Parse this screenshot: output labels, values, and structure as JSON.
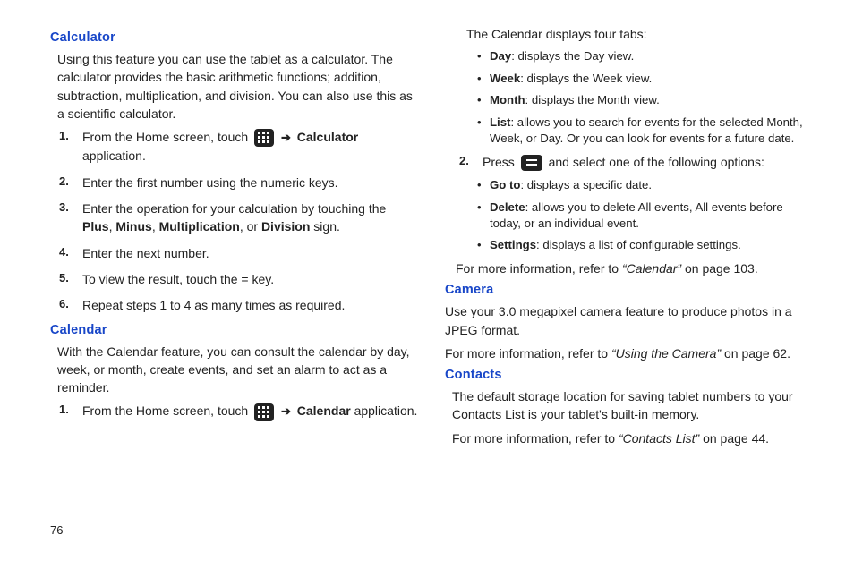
{
  "pageNumber": "76",
  "left": {
    "calculator": {
      "heading": "Calculator",
      "intro": "Using this feature you can use the tablet as a calculator. The calculator provides the basic arithmetic functions; addition, subtraction, multiplication, and division. You can also use this as a scientific calculator.",
      "step1_a": "From the Home screen, touch ",
      "step1_b": "Calculator",
      "step1_c": " application.",
      "step2": "Enter the first number using the numeric keys.",
      "step3_a": "Enter the operation for your calculation by touching the ",
      "step3_plus": "Plus",
      "step3_minus": "Minus",
      "step3_mult": "Multiplication",
      "step3_div": "Division",
      "step3_or": ", or ",
      "step3_sign": " sign.",
      "step4": "Enter the next number.",
      "step5": "To view the result, touch the = key.",
      "step6": "Repeat steps 1 to 4 as many times as required.",
      "comma": ", "
    },
    "calendar": {
      "heading": "Calendar",
      "intro": "With the Calendar feature, you can consult the calendar by day, week, or month, create events, and set an alarm to act as a reminder.",
      "step1_a": "From the Home screen, touch ",
      "step1_b": "Calendar",
      "step1_c": " application."
    }
  },
  "right": {
    "tabsIntro": "The Calendar displays four tabs:",
    "tabs": {
      "day_b": "Day",
      "day_t": ": displays the Day view.",
      "week_b": "Week",
      "week_t": ": displays the Week view.",
      "month_b": "Month",
      "month_t": ": displays the Month view.",
      "list_b": "List",
      "list_t": ": allows you to search for events for the selected Month, Week, or Day. Or you can look for events for a future date."
    },
    "step2_a": "Press ",
    "step2_b": " and select one of the following options:",
    "options": {
      "goto_b": "Go to",
      "goto_t": ": displays a specific date.",
      "delete_b": "Delete",
      "delete_t": ": allows you to delete All events, All events before today, or an individual event.",
      "settings_b": "Settings",
      "settings_t": ": displays a list of configurable settings."
    },
    "calRef_a": "For more information, refer to ",
    "calRef_i": "“Calendar” ",
    "calRef_b": " on page 103.",
    "camera": {
      "heading": "Camera",
      "intro": "Use your 3.0 megapixel camera feature to produce photos in a JPEG format.",
      "ref_a": "For more information, refer to ",
      "ref_i": "“Using the Camera” ",
      "ref_b": " on page 62."
    },
    "contacts": {
      "heading": "Contacts",
      "intro": "The default storage location for saving tablet numbers to your Contacts List is your tablet's built-in memory.",
      "ref_a": "For more information, refer to ",
      "ref_i": "“Contacts List” ",
      "ref_b": " on page 44."
    }
  }
}
